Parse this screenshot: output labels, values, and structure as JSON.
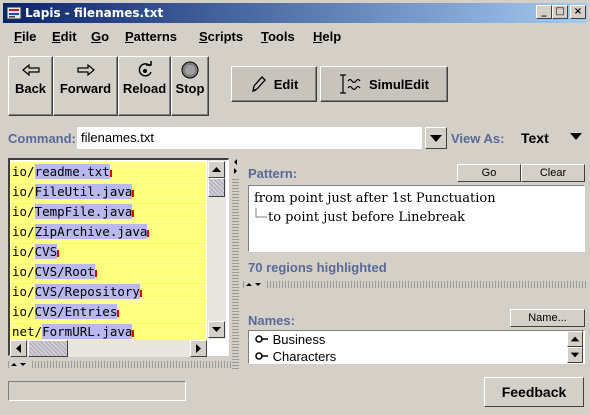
{
  "window": {
    "title": "Lapis - filenames.txt",
    "controls": {
      "minimize": "_",
      "maximize": "□",
      "close": "×"
    }
  },
  "menu": [
    {
      "label": "File",
      "mnemonic": "F",
      "rest": "ile"
    },
    {
      "label": "Edit",
      "mnemonic": "E",
      "rest": "dit"
    },
    {
      "label": "Go",
      "mnemonic": "G",
      "rest": "o"
    },
    {
      "label": "Patterns",
      "mnemonic": "P",
      "rest": "atterns"
    },
    {
      "label": "Scripts",
      "mnemonic": "S",
      "rest": "cripts"
    },
    {
      "label": "Tools",
      "mnemonic": "T",
      "rest": "ools"
    },
    {
      "label": "Help",
      "mnemonic": "H",
      "rest": "elp"
    }
  ],
  "toolbar": {
    "back": "Back",
    "forward": "Forward",
    "reload": "Reload",
    "stop": "Stop",
    "edit": "Edit",
    "simuledit": "SimulEdit"
  },
  "command": {
    "label": "Command:",
    "value": "filenames.txt",
    "view_as_label": "View As:",
    "view_as_value": "Text"
  },
  "document": {
    "lines": [
      {
        "prefix": "io/",
        "highlight": "readme.txt"
      },
      {
        "prefix": "io/",
        "highlight": "FileUtil.java"
      },
      {
        "prefix": "io/",
        "highlight": "TempFile.java"
      },
      {
        "prefix": "io/",
        "highlight": "ZipArchive.java"
      },
      {
        "prefix": "io/",
        "highlight": "CVS"
      },
      {
        "prefix": "io/",
        "highlight": "CVS/Root"
      },
      {
        "prefix": "io/",
        "highlight": "CVS/Repository"
      },
      {
        "prefix": "io/",
        "highlight": "CVS/Entries"
      },
      {
        "prefix": "net/",
        "highlight": "FormURL.java"
      }
    ]
  },
  "pattern": {
    "label": "Pattern:",
    "go": "Go",
    "clear": "Clear",
    "line1": "from point just after 1st Punctuation",
    "line2": "to point just before Linebreak",
    "status": "70 regions highlighted"
  },
  "names": {
    "label": "Names:",
    "button": "Name...",
    "items": [
      "Business",
      "Characters"
    ]
  },
  "status": {
    "feedback": "Feedback"
  }
}
